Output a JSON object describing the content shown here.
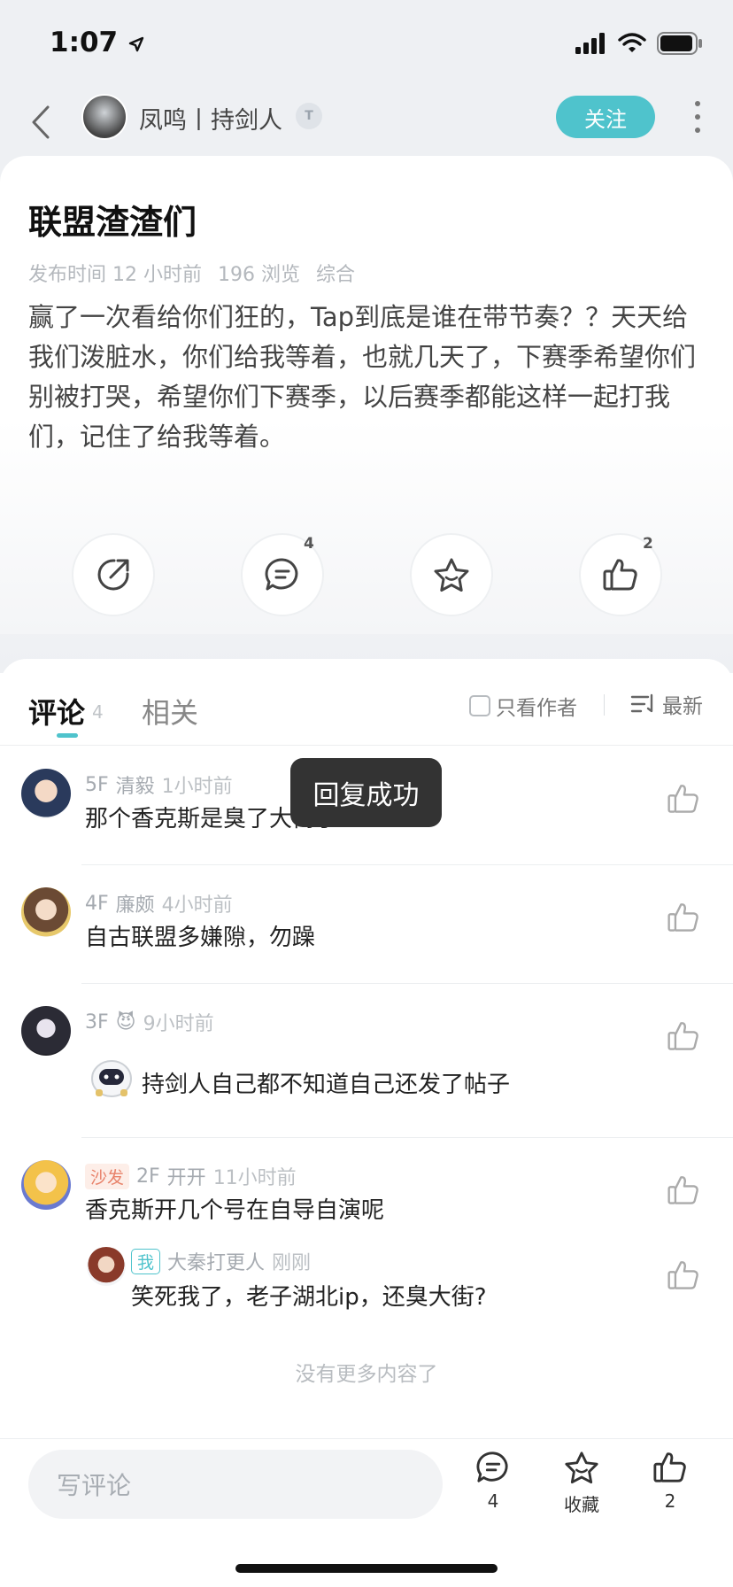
{
  "status_bar": {
    "time": "1:07"
  },
  "header": {
    "author_name": "凤鸣丨持剑人",
    "level_badge": "T",
    "follow_label": "关注"
  },
  "post": {
    "title": "联盟渣渣们",
    "meta": {
      "published": "发布时间 12 小时前",
      "views": "196 浏览",
      "category": "综合"
    },
    "body": "赢了一次看给你们狂的，Tap到底是谁在带节奏？？天天给我们泼脏水，你们给我等着，也就几天了，下赛季希望你们别被打哭，希望你们下赛季，以后赛季都能这样一起打我们，记住了给我等着。",
    "actions": {
      "comment_count": "4",
      "like_count": "2"
    }
  },
  "comments_section": {
    "tab_comments": "评论",
    "tab_comments_count": "4",
    "tab_related": "相关",
    "author_only": "只看作者",
    "sort": "最新",
    "items": [
      {
        "floor": "5F",
        "user": "清毅",
        "time": "1小时前",
        "text": "那个香克斯是臭了大街了"
      },
      {
        "floor": "4F",
        "user": "廉颇",
        "time": "4小时前",
        "text": "自古联盟多嫌隙，勿躁"
      },
      {
        "floor": "3F",
        "user": "😈",
        "time": "9小时前",
        "text": "持剑人自己都不知道自己还发了帖子"
      },
      {
        "badge": "沙发",
        "floor": "2F",
        "user": "开开",
        "time": "11小时前",
        "text": "香克斯开几个号在自导自演呢"
      }
    ],
    "reply": {
      "badge": "我",
      "user": "大秦打更人",
      "time": "刚刚",
      "text": "笑死我了，老子湖北ip，还臭大街?"
    },
    "no_more": "没有更多内容了"
  },
  "toast": "回复成功",
  "bottom_bar": {
    "placeholder": "写评论",
    "comment_count": "4",
    "favorite_label": "收藏",
    "like_count": "2"
  },
  "colors": {
    "accent": "#4fc3cc",
    "toast_bg": "#333333",
    "sofa_badge": "#e8826a"
  }
}
